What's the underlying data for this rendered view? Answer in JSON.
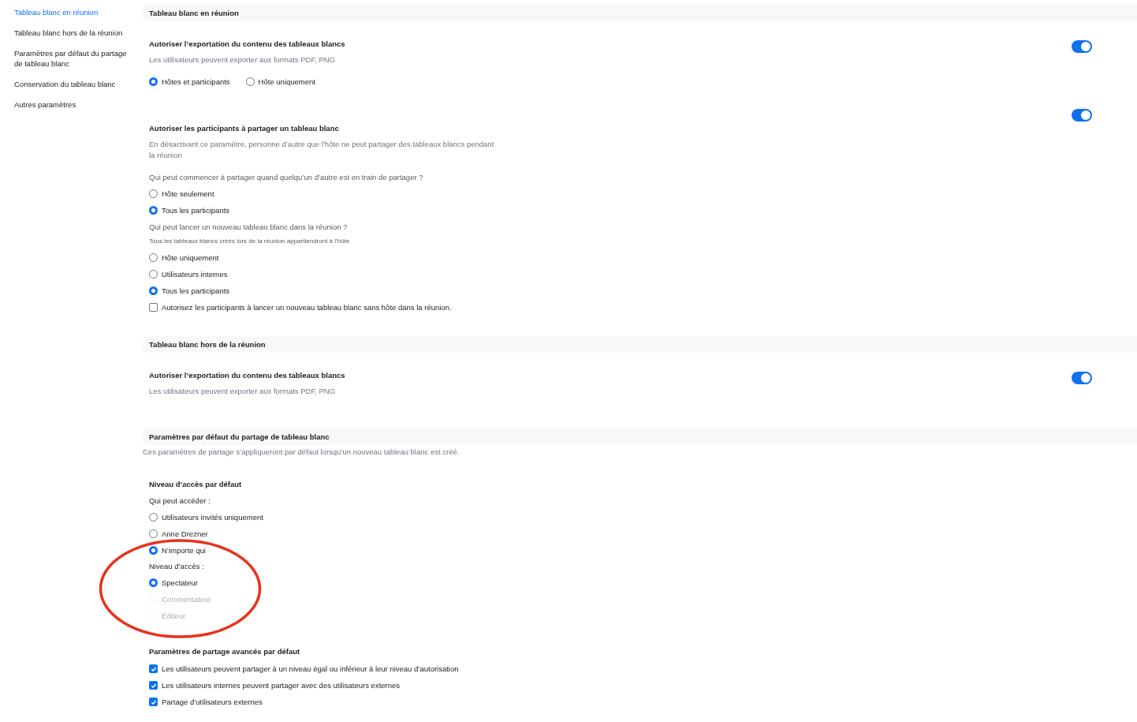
{
  "sidebar": {
    "items": [
      {
        "label": "Tableau blanc en réunion",
        "selected": true
      },
      {
        "label": "Tableau blanc hors de la réunion",
        "selected": false
      },
      {
        "label": "Paramètres par défaut du partage de tableau blanc",
        "selected": false
      },
      {
        "label": "Conservation du tableau blanc",
        "selected": false
      },
      {
        "label": "Autres paramètres",
        "selected": false
      }
    ]
  },
  "sections": [
    {
      "title": "Tableau blanc en réunion",
      "settings": [
        {
          "title": "Autoriser l’exportation du contenu des tableaux blancs",
          "description": "Les utilisateurs peuvent exporter aux formats PDF, PNG",
          "on": true,
          "items": [
            {
              "kind": "radio_row",
              "options": [
                {
                  "label": "Hôtes et participants",
                  "selected": true
                },
                {
                  "label": "Hôte uniquement",
                  "selected": false
                }
              ]
            }
          ]
        },
        {
          "title": "Autoriser les participants à partager un tableau blanc",
          "description": "En désactivant ce paramètre, personne d’autre que l’hôte ne peut partager des tableaux blancs pendant la réunion",
          "on": true,
          "items": [
            {
              "kind": "question",
              "text": "Qui peut commencer à partager quand quelqu’un d’autre est en train de partager ?"
            },
            {
              "kind": "radio",
              "label": "Hôte seulement",
              "selected": false,
              "disabled": false
            },
            {
              "kind": "radio",
              "label": "Tous les participants",
              "selected": true,
              "disabled": false
            },
            {
              "kind": "question",
              "text": "Qui peut lancer un nouveau tableau blanc dans la réunion ?"
            },
            {
              "kind": "note",
              "text": "Tous les tableaux blancs créés lors de la réunion appartiendront à l’hôte"
            },
            {
              "kind": "radio",
              "label": "Hôte uniquement",
              "selected": false,
              "disabled": false
            },
            {
              "kind": "radio",
              "label": "Utilisateurs internes",
              "selected": false,
              "disabled": false
            },
            {
              "kind": "radio",
              "label": "Tous les participants",
              "selected": true,
              "disabled": false
            },
            {
              "kind": "checkbox",
              "label": "Autorisez les participants à lancer un nouveau tableau blanc sans hôte dans la réunion.",
              "checked": false
            }
          ]
        }
      ]
    },
    {
      "title": "Tableau blanc hors de la réunion",
      "settings": [
        {
          "title": "Autoriser l’exportation du contenu des tableaux blancs",
          "description": "Les utilisateurs peuvent exporter aux formats PDF, PNG",
          "on": true
        }
      ]
    },
    {
      "title": "Paramètres par défaut du partage de tableau blanc",
      "description": "Ces paramètres de partage s’appliqueront par défaut lorsqu’un nouveau tableau blanc est créé.",
      "settings": [
        {
          "title": "Niveau d’accès par défaut",
          "items": [
            {
              "kind": "label",
              "text": "Qui peut accéder :"
            },
            {
              "kind": "radio",
              "label": "Utilisateurs invités uniquement",
              "selected": false,
              "disabled": false
            },
            {
              "kind": "radio",
              "label": "Anne Drezner",
              "selected": false,
              "disabled": false
            },
            {
              "kind": "radio",
              "label": "N’importe qui",
              "selected": true,
              "disabled": false
            },
            {
              "kind": "label",
              "text": "Niveau d’accès :"
            },
            {
              "kind": "radio",
              "label": "Spectateur",
              "selected": true,
              "disabled": false
            },
            {
              "kind": "radio",
              "label": "Commentateur",
              "selected": false,
              "disabled": true
            },
            {
              "kind": "radio",
              "label": "Éditeur",
              "selected": false,
              "disabled": true
            }
          ]
        },
        {
          "title": "Paramètres de partage avancés par défaut",
          "items": [
            {
              "kind": "checkbox",
              "label": "Les utilisateurs peuvent partager à un niveau égal ou inférieur à leur niveau d’autorisation",
              "checked": true
            },
            {
              "kind": "checkbox",
              "label": "Les utilisateurs internes peuvent partager avec des utilisateurs externes",
              "checked": true
            },
            {
              "kind": "checkbox",
              "label": "Partage d’utilisateurs externes",
              "checked": true
            }
          ]
        }
      ]
    }
  ]
}
